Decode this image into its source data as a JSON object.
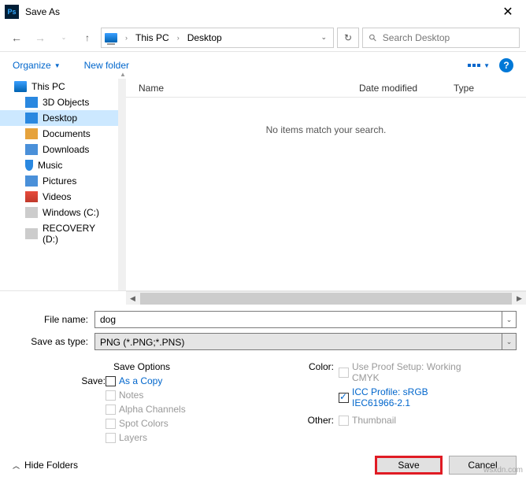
{
  "window": {
    "title": "Save As",
    "close": "✕"
  },
  "nav": {
    "crumbs": [
      "This PC",
      "Desktop"
    ],
    "search_placeholder": "Search Desktop"
  },
  "toolbar": {
    "organize": "Organize",
    "newfolder": "New folder",
    "help": "?"
  },
  "columns": {
    "name": "Name",
    "date": "Date modified",
    "type": "Type"
  },
  "empty": "No items match your search.",
  "tree": [
    {
      "label": "This PC",
      "icon": "pc",
      "root": true
    },
    {
      "label": "3D Objects",
      "icon": "3d"
    },
    {
      "label": "Desktop",
      "icon": "desk",
      "selected": true
    },
    {
      "label": "Documents",
      "icon": "doc"
    },
    {
      "label": "Downloads",
      "icon": "dl"
    },
    {
      "label": "Music",
      "icon": "music"
    },
    {
      "label": "Pictures",
      "icon": "pic"
    },
    {
      "label": "Videos",
      "icon": "vid"
    },
    {
      "label": "Windows (C:)",
      "icon": "drive"
    },
    {
      "label": "RECOVERY (D:)",
      "icon": "drive"
    }
  ],
  "form": {
    "filename_label": "File name:",
    "filename_value": "dog",
    "filetype_label": "Save as type:",
    "filetype_value": "PNG (*.PNG;*.PNS)"
  },
  "options": {
    "save_options": "Save Options",
    "save_label": "Save:",
    "as_copy": "As a Copy",
    "notes": "Notes",
    "alpha": "Alpha Channels",
    "spot": "Spot Colors",
    "layers": "Layers",
    "color_label": "Color:",
    "proof": "Use Proof Setup: Working CMYK",
    "icc": "ICC Profile: sRGB IEC61966-2.1",
    "other_label": "Other:",
    "thumb": "Thumbnail"
  },
  "bottom": {
    "hide": "Hide Folders",
    "save": "Save",
    "cancel": "Cancel"
  },
  "watermark": "wsxdn.com"
}
